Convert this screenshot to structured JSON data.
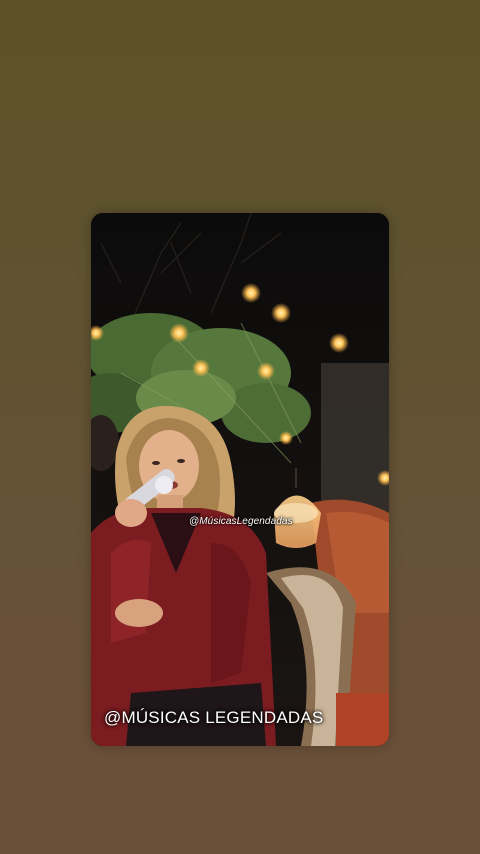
{
  "story": {
    "watermark_small": "@MúsicasLegendadas",
    "watermark_large": "@MÚSICAS LEGENDADAS"
  },
  "colors": {
    "background_top": "#5d5128",
    "background_bottom": "#6a4f39",
    "jacket": "#7a1c20",
    "string_lights": "#ffcc66"
  }
}
